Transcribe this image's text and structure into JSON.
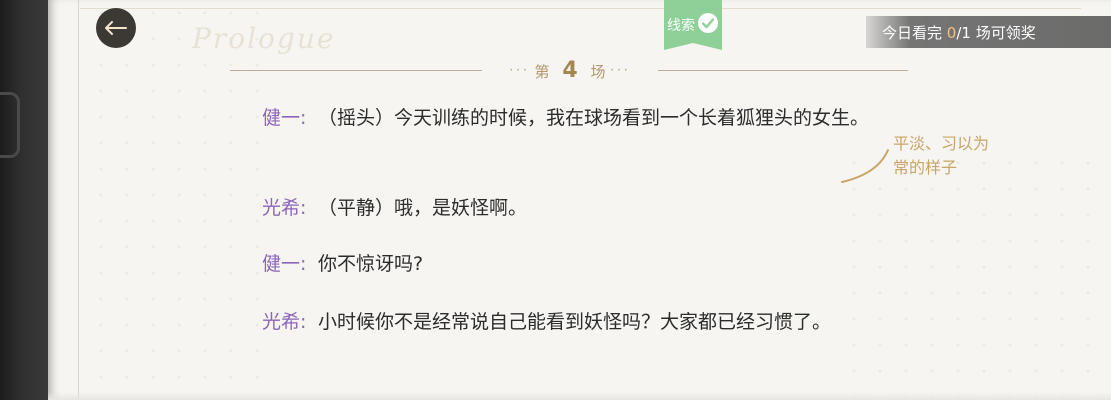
{
  "header": {
    "back_label": "",
    "clue_tab": {
      "label": "线索",
      "status": "collected"
    },
    "daily_reward": {
      "prefix": "今日看完 ",
      "current": "0",
      "sep_total": "/1",
      "suffix": " 场可领奖"
    }
  },
  "scene": {
    "prefix": "第",
    "number": "4",
    "suffix": "场"
  },
  "dialogue": [
    {
      "speaker": "健一:",
      "text": "（摇头）今天训练的时候，我在球场看到一个长着狐狸头的女生。"
    },
    {
      "speaker": "光希:",
      "text": "（平静）哦，是妖怪啊。"
    },
    {
      "speaker": "健一:",
      "text": "你不惊讶吗?"
    },
    {
      "speaker": "光希:",
      "text": "小时候你不是经常说自己能看到妖怪吗？大家都已经习惯了。"
    }
  ],
  "annotation": {
    "text": "平淡、习以为常的样子"
  },
  "colors": {
    "speaker": "#8b67b8",
    "accent_gold": "#b39a6d",
    "clue_green": "#8fcf98",
    "page_bg": "#f6f5f2"
  },
  "icons": {
    "back": "back-arrow-icon",
    "clue_check": "check-icon"
  }
}
